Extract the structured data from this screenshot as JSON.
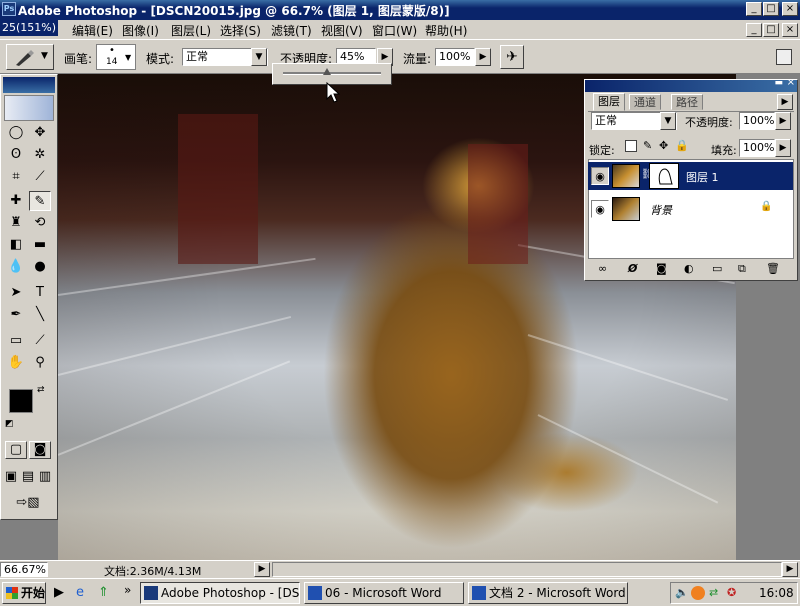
{
  "window": {
    "title": "Adobe Photoshop - [DSCN20015.jpg @ 66.7% (图层 1, 图层蒙版/8)]",
    "doc_strip": "25(151%)",
    "controls": [
      "_",
      "□",
      "×"
    ]
  },
  "menubar": {
    "items": [
      "文件(F)",
      "编辑(E)",
      "图像(I)",
      "图层(L)",
      "选择(S)",
      "滤镜(T)",
      "视图(V)",
      "窗口(W)",
      "帮助(H)"
    ],
    "doc_controls": [
      "_",
      "□",
      "×"
    ]
  },
  "options": {
    "brush_label": "画笔:",
    "brush_size": "14",
    "mode_label": "模式:",
    "mode_value": "正常",
    "opacity_label": "不透明度:",
    "opacity_value": "45%",
    "flow_label": "流量:",
    "flow_value": "100%",
    "opacity_slider_level": 0.45
  },
  "layers_panel": {
    "tabs": [
      "图层",
      "通道",
      "路径"
    ],
    "active_tab": "图层",
    "blend_mode": "正常",
    "opacity_label": "不透明度:",
    "opacity_value": "100%",
    "lock_label": "锁定:",
    "fill_label": "填充:",
    "fill_value": "100%",
    "layers": [
      {
        "name": "图层 1",
        "selected": true,
        "has_mask": true
      },
      {
        "name": "背景",
        "selected": false,
        "locked": true
      }
    ],
    "footer_icons": [
      "link-icon",
      "effects-icon",
      "mask-icon",
      "adjustment-icon",
      "folder-icon",
      "new-layer-icon",
      "trash-icon"
    ]
  },
  "statusbar": {
    "zoom": "66.67%",
    "doc_info": "文档:2.36M/4.13M"
  },
  "taskbar": {
    "start_label": "开始",
    "tasks": [
      {
        "label": "Adobe Photoshop - [DSC...",
        "active": true
      },
      {
        "label": "06 - Microsoft Word",
        "active": false
      },
      {
        "label": "文档 2 - Microsoft Word",
        "active": false
      }
    ],
    "clock": "16:08",
    "chevron": "»"
  },
  "colors": {
    "titlebar": "#0a246a",
    "chrome": "#d4d0c8",
    "selected_layer": "#0a246a"
  }
}
